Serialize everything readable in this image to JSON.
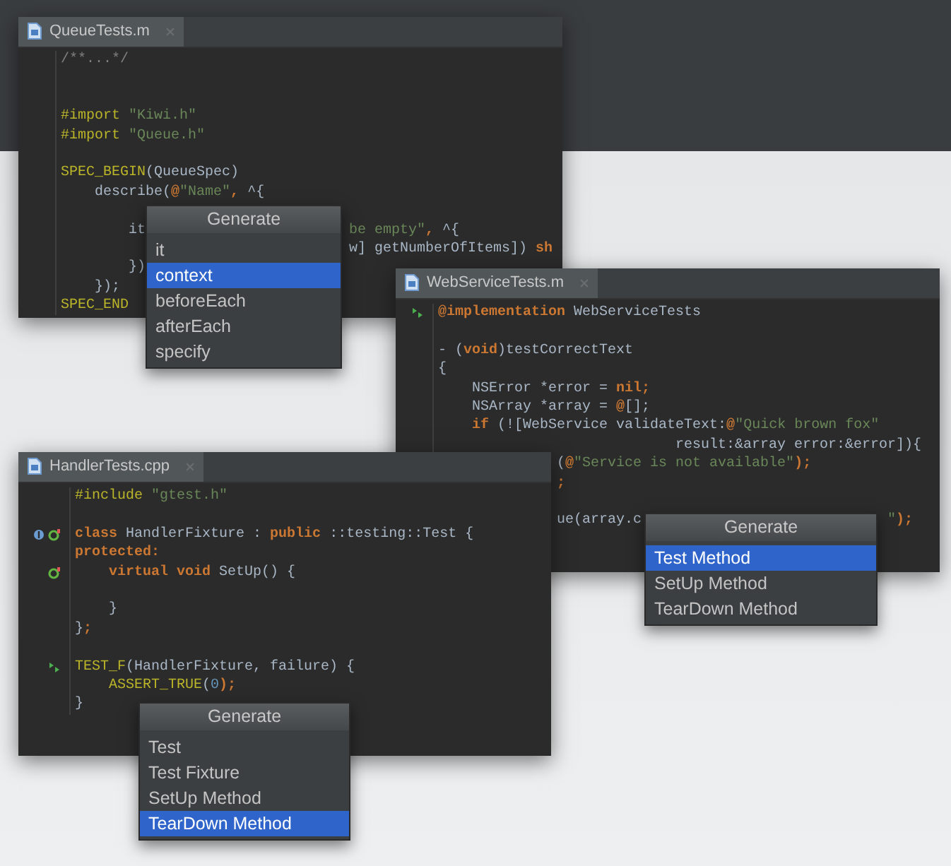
{
  "windows": [
    {
      "tab": {
        "label": "QueueTests.m",
        "selected": true
      },
      "lines": [
        {
          "kind": "code",
          "segments": [
            [
              {
                "kind": "comment",
                "text": "/**...*/"
              }
            ]
          ]
        },
        {
          "kind": "blank"
        },
        {
          "kind": "blank"
        },
        {
          "kind": "code",
          "segments": [
            [
              {
                "kind": "macro",
                "text": "#import"
              },
              {
                "kind": "string",
                "text": " \"Kiwi.h\""
              }
            ]
          ]
        },
        {
          "kind": "code",
          "segments": [
            [
              {
                "kind": "macro",
                "text": "#import"
              },
              {
                "kind": "string",
                "text": " \"Queue.h\""
              }
            ]
          ]
        },
        {
          "kind": "blank"
        },
        {
          "kind": "code",
          "segments": [
            [
              {
                "kind": "macro",
                "text": "SPEC_BEGIN"
              },
              {
                "kind": "plain",
                "text": "(QueueSpec)"
              }
            ]
          ]
        },
        {
          "kind": "code",
          "segments": [
            [
              {
                "kind": "plain",
                "text": "describe("
              },
              {
                "kind": "keyword",
                "text": "@"
              },
              {
                "kind": "string",
                "text": "\"Name\""
              },
              {
                "kind": "keyword",
                "text": ", "
              },
              {
                "kind": "plain",
                "text": "^{"
              }
            ]
          ]
        },
        {
          "kind": "blank"
        },
        {
          "kind": "code",
          "segments": [
            [
              {
                "kind": "plain",
                "text": "it"
              }
            ],
            [
              {
                "kind": "string",
                "text": "be empty\""
              },
              {
                "kind": "keyword",
                "text": ", "
              },
              {
                "kind": "plain",
                "text": "^{"
              }
            ]
          ]
        },
        {
          "kind": "code",
          "segments": [
            [
              {
                "kind": "plain",
                "text": "w] getNumberOfItems]) "
              },
              {
                "kind": "keyword",
                "text": "sh"
              }
            ]
          ]
        },
        {
          "kind": "code",
          "segments": [
            [
              {
                "kind": "plain",
                "text": "})"
              }
            ]
          ]
        },
        {
          "kind": "code",
          "segments": [
            [
              {
                "kind": "plain",
                "text": "});"
              }
            ]
          ]
        },
        {
          "kind": "code",
          "segments": [
            [
              {
                "kind": "macro",
                "text": "SPEC_END"
              }
            ]
          ]
        }
      ],
      "generate_popup": {
        "title": "Generate",
        "items": [
          {
            "label": "it",
            "selected": false
          },
          {
            "label": "context",
            "selected": true
          },
          {
            "label": "beforeEach",
            "selected": false
          },
          {
            "label": "afterEach",
            "selected": false
          },
          {
            "label": "specify",
            "selected": false
          }
        ]
      }
    },
    {
      "tab": {
        "label": "WebServiceTests.m",
        "selected": true
      },
      "lines": [
        {
          "kind": "code",
          "segments": [
            [
              {
                "kind": "keyword",
                "text": "@implementation"
              },
              {
                "kind": "plain",
                "text": " WebServiceTests"
              }
            ]
          ]
        },
        {
          "kind": "blank"
        },
        {
          "kind": "code",
          "segments": [
            [
              {
                "kind": "plain",
                "text": "- ("
              },
              {
                "kind": "keyword",
                "text": "void"
              },
              {
                "kind": "plain",
                "text": ")testCorrectText"
              }
            ]
          ]
        },
        {
          "kind": "code",
          "segments": [
            [
              {
                "kind": "plain",
                "text": "{"
              }
            ]
          ]
        },
        {
          "kind": "code",
          "segments": [
            [
              {
                "kind": "plain",
                "text": "NSError *error = "
              },
              {
                "kind": "keyword",
                "text": "nil;"
              }
            ]
          ]
        },
        {
          "kind": "code",
          "segments": [
            [
              {
                "kind": "plain",
                "text": "NSArray *array = "
              },
              {
                "kind": "keyword",
                "text": "@"
              },
              {
                "kind": "plain",
                "text": "[];"
              }
            ]
          ]
        },
        {
          "kind": "code",
          "segments": [
            [
              {
                "kind": "keyword",
                "text": "if"
              },
              {
                "kind": "plain",
                "text": " (![WebService validateText:"
              },
              {
                "kind": "keyword",
                "text": "@"
              },
              {
                "kind": "string",
                "text": "\"Quick brown fox\""
              }
            ]
          ]
        },
        {
          "kind": "code",
          "segments": [
            [
              {
                "kind": "plain",
                "text": "result:&array error:&error]){"
              }
            ]
          ]
        },
        {
          "kind": "code",
          "segments": [
            [
              {
                "kind": "plain",
                "text": "("
              },
              {
                "kind": "keyword",
                "text": "@"
              },
              {
                "kind": "string",
                "text": "\"Service is not available\""
              },
              {
                "kind": "keyword",
                "text": ");"
              }
            ]
          ]
        },
        {
          "kind": "code",
          "segments": [
            [
              {
                "kind": "keyword",
                "text": ";"
              }
            ]
          ]
        },
        {
          "kind": "blank"
        },
        {
          "kind": "code",
          "segments": [
            [
              {
                "kind": "plain",
                "text": "ue(array.c"
              }
            ],
            [
              {
                "kind": "string",
                "text": "\""
              },
              {
                "kind": "keyword",
                "text": ");"
              }
            ]
          ]
        }
      ],
      "generate_popup": {
        "title": "Generate",
        "items": [
          {
            "label": "Test Method",
            "selected": true
          },
          {
            "label": "SetUp Method",
            "selected": false
          },
          {
            "label": "TearDown Method",
            "selected": false
          }
        ]
      }
    },
    {
      "tab": {
        "label": "HandlerTests.cpp",
        "selected": true
      },
      "lines": [
        {
          "kind": "code",
          "segments": [
            [
              {
                "kind": "macro",
                "text": "#include"
              },
              {
                "kind": "string",
                "text": " \"gtest.h\""
              }
            ]
          ]
        },
        {
          "kind": "blank"
        },
        {
          "kind": "code",
          "segments": [
            [
              {
                "kind": "keyword",
                "text": "class"
              },
              {
                "kind": "plain",
                "text": " HandlerFixture : "
              },
              {
                "kind": "keyword",
                "text": "public"
              },
              {
                "kind": "plain",
                "text": " ::testing::Test {"
              }
            ]
          ]
        },
        {
          "kind": "code",
          "segments": [
            [
              {
                "kind": "keyword",
                "text": "protected:"
              }
            ]
          ]
        },
        {
          "kind": "code",
          "segments": [
            [
              {
                "kind": "keyword",
                "text": "virtual void"
              },
              {
                "kind": "plain",
                "text": " SetUp() {"
              }
            ]
          ]
        },
        {
          "kind": "blank"
        },
        {
          "kind": "code",
          "segments": [
            [
              {
                "kind": "plain",
                "text": "}"
              }
            ]
          ]
        },
        {
          "kind": "code",
          "segments": [
            [
              {
                "kind": "plain",
                "text": "}"
              },
              {
                "kind": "keyword",
                "text": ";"
              }
            ]
          ]
        },
        {
          "kind": "blank"
        },
        {
          "kind": "code",
          "segments": [
            [
              {
                "kind": "macro",
                "text": "TEST_F"
              },
              {
                "kind": "plain",
                "text": "(HandlerFixture, failure) {"
              }
            ]
          ]
        },
        {
          "kind": "code",
          "segments": [
            [
              {
                "kind": "macro",
                "text": "ASSERT_TRUE"
              },
              {
                "kind": "plain",
                "text": "("
              },
              {
                "kind": "number",
                "text": "0"
              },
              {
                "kind": "keyword",
                "text": ");"
              }
            ]
          ]
        },
        {
          "kind": "code",
          "segments": [
            [
              {
                "kind": "plain",
                "text": "}"
              }
            ]
          ]
        }
      ],
      "generate_popup": {
        "title": "Generate",
        "items": [
          {
            "label": "Test",
            "selected": false
          },
          {
            "label": "Test Fixture",
            "selected": false
          },
          {
            "label": "SetUp Method",
            "selected": false
          },
          {
            "label": "TearDown Method",
            "selected": true
          }
        ]
      }
    }
  ]
}
